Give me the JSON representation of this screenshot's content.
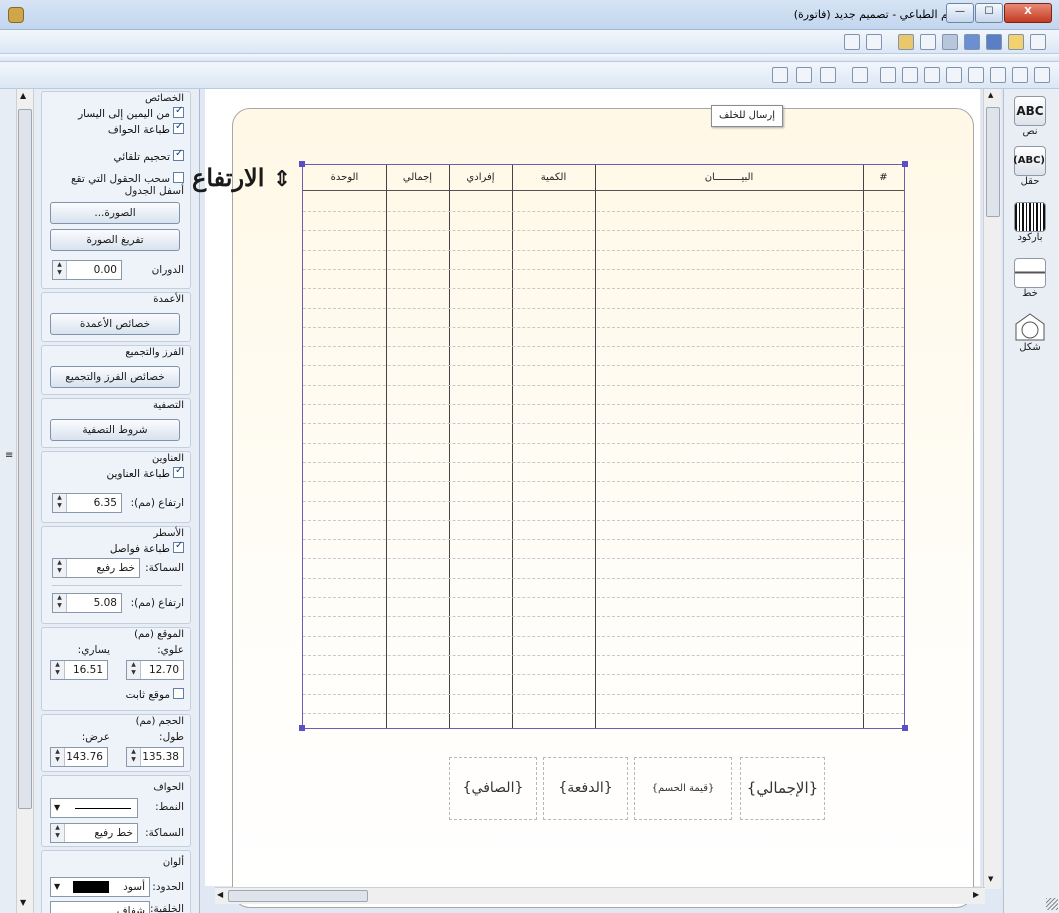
{
  "window": {
    "title": "المصمم الطباعي - تصميم جديد (فاتورة)",
    "minimize": "—",
    "maximize": "☐",
    "close": "X"
  },
  "sidebar": {
    "props_title": "الخصائص",
    "rtl_label": "من اليمين إلى اليسار",
    "print_borders_label": "طباعة الحواف",
    "auto_size_label": "تحجيم تلقائي",
    "pull_fields_label": "سحب الحقول التي تقع أسفل الجدول",
    "image_button": "الصورة...",
    "clear_image_button": "تفريغ الصورة",
    "rotation_label": "الدوران",
    "rotation_value": "0.00",
    "columns_title": "الأعمدة",
    "columns_button": "خصائص الأعمدة",
    "sort_title": "الفرز والتجميع",
    "sort_button": "خصائص الفرز والتجميع",
    "filter_title": "التصفية",
    "filter_button": "شروط التصفية",
    "headers_title": "العناوين",
    "print_headers_label": "طباعة العناوين",
    "header_height_label": "ارتفاع (مم):",
    "header_height_value": "6.35",
    "rows_title": "الأسطر",
    "print_separators_label": "طباعة فواصل",
    "thickness_label": "السماكة:",
    "thickness_value": "خط رفيع",
    "row_height_label": "ارتفاع (مم):",
    "row_height_value": "5.08",
    "position_title": "الموقع (مم)",
    "top_label": "علوي:",
    "left_label": "يساري:",
    "top_value": "12.70",
    "left_value": "16.51",
    "fixed_position_label": "موقع ثابت",
    "size_title": "الحجم (مم)",
    "length_label": "طول:",
    "width_label": "عرض:",
    "length_value": "135.38",
    "width_value": "143.76",
    "borders_title": "الحواف",
    "style_label": "النمط:",
    "border_thickness_label": "السماكة:",
    "border_thickness_value": "خط رفيع",
    "colors_title": "ألوان",
    "borders_color_label": "الحدود:",
    "borders_color_value": "أسود",
    "background_label": "الخلفية:",
    "background_value": "شفاف"
  },
  "canvas": {
    "send_back": "إرسال للخلف",
    "callout": "الارتفاع",
    "columns": [
      "#",
      "البيـــــــــان",
      "الكمية",
      "إفرادي",
      "إجمالي",
      "الوحدة"
    ],
    "footer_fields": [
      "{الإجمالي}",
      "{قيمة الحسم}",
      "{الدفعة}",
      "{الصافي}"
    ]
  },
  "tools": {
    "text": "نص",
    "field": "حقل",
    "barcode": "باركود",
    "line": "خط",
    "shape": "شكل"
  },
  "colors": {
    "accent": "#5a4fc5",
    "paper": "#fff8e6"
  }
}
